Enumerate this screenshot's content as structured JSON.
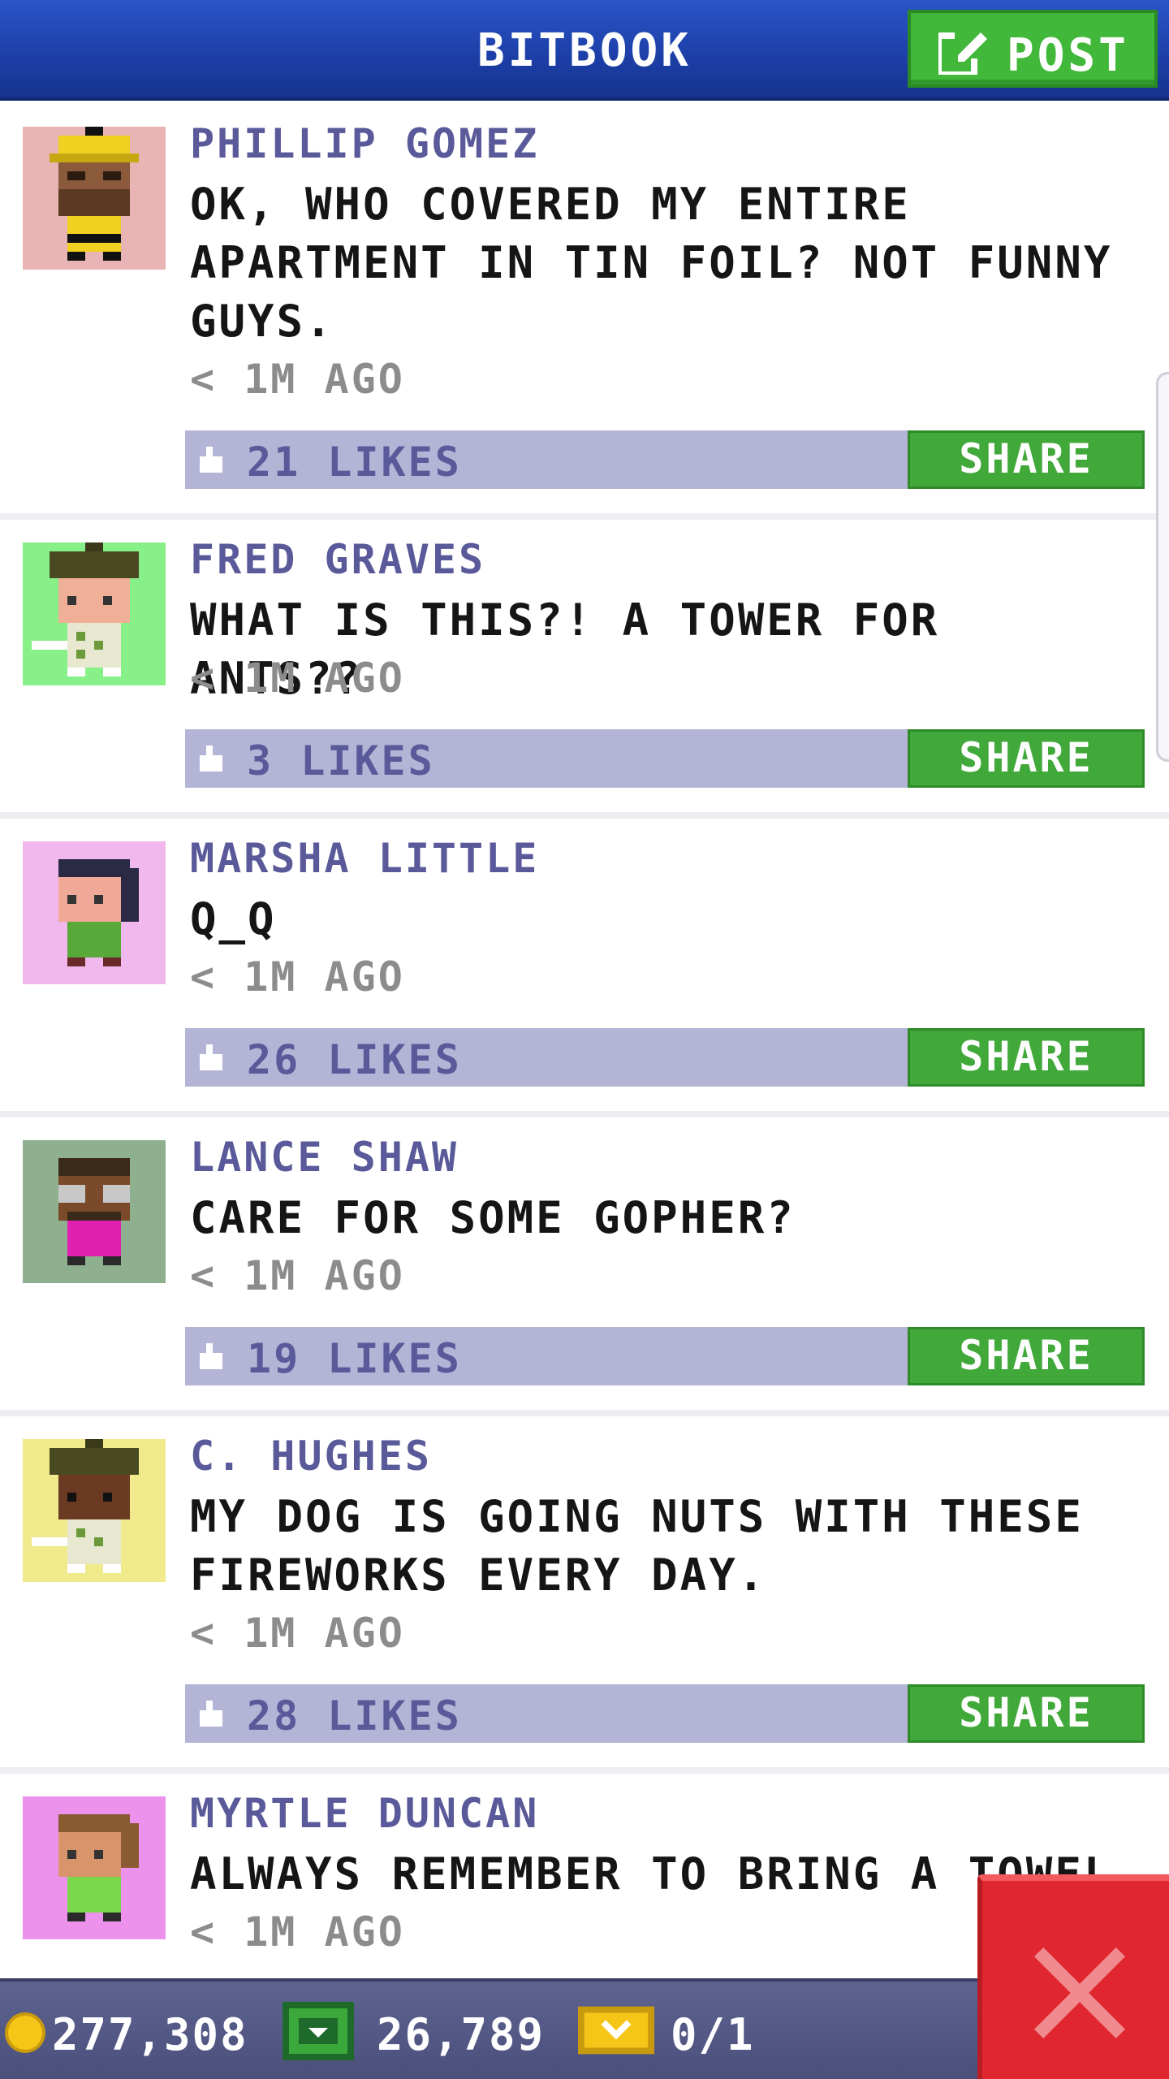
{
  "header": {
    "title": "BITBOOK",
    "post_label": "POST"
  },
  "posts": [
    {
      "author": "PHILLIP GOMEZ",
      "message": "OK, WHO COVERED MY ENTIRE APARTMENT IN TIN FOIL? NOT FUNNY GUYS.",
      "time": "< 1M AGO",
      "likes": "21 LIKES",
      "share_label": "SHARE",
      "avatar_bg": "#e8b4b4"
    },
    {
      "author": "FRED GRAVES",
      "message": "WHAT IS THIS?! A TOWER FOR ANTS??",
      "time": "< 1M AGO",
      "likes": "3 LIKES",
      "share_label": "SHARE",
      "avatar_bg": "#88f088"
    },
    {
      "author": "MARSHA LITTLE",
      "message": "Q_Q",
      "time": "< 1M AGO",
      "likes": "26 LIKES",
      "share_label": "SHARE",
      "avatar_bg": "#f0b8ec"
    },
    {
      "author": "LANCE SHAW",
      "message": "CARE FOR SOME GOPHER?",
      "time": "< 1M AGO",
      "likes": "19 LIKES",
      "share_label": "SHARE",
      "avatar_bg": "#8fb08f"
    },
    {
      "author": "C. HUGHES",
      "message": "MY DOG IS GOING NUTS WITH THESE FIREWORKS EVERY DAY.",
      "time": "< 1M AGO",
      "likes": "28 LIKES",
      "share_label": "SHARE",
      "avatar_bg": "#f0ea8c"
    },
    {
      "author": "MYRTLE DUNCAN",
      "message": "ALWAYS REMEMBER TO BRING A TOWEL",
      "time": "< 1M AGO",
      "avatar_bg": "#ec92ec"
    }
  ],
  "footer": {
    "coins": "277,308",
    "bux": "26,789",
    "tickets": "0/1"
  },
  "colors": {
    "header_blue": "#1c3ea6",
    "accent_green": "#41b83a",
    "action_bar": "#b4b5d6",
    "close_red": "#e0262e"
  },
  "icons": {
    "post": "edit-icon",
    "like": "thumbs-up-icon",
    "coin": "coin-icon",
    "bux": "bux-icon",
    "ticket": "ticket-icon",
    "close": "close-icon"
  }
}
